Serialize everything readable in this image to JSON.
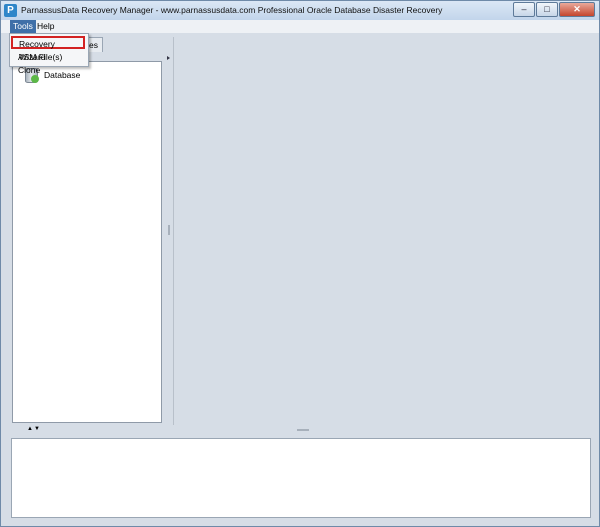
{
  "window": {
    "title": "ParnassusData Recovery Manager - www.parnassusdata.com  Professional Oracle Database Disaster Recovery",
    "app_icon_letter": "P",
    "controls": {
      "minimize": "–",
      "maximize": "□",
      "close": "✕"
    }
  },
  "menubar": {
    "tools": "Tools",
    "help": "Help"
  },
  "tools_menu": {
    "items": [
      "Recovery Wizard",
      "ASM File(s) Clone"
    ],
    "highlighted": "Recovery Wizard"
  },
  "left_panel": {
    "tab_visible_text": "es",
    "tree": {
      "items": [
        {
          "label": "Database",
          "icon": "database-add-icon"
        }
      ]
    }
  },
  "splitter": {
    "arrows": "▲▼"
  },
  "colors": {
    "menu_active": "#3f6fa8",
    "highlight_border": "#d32222",
    "panel_bg": "#d6dde6"
  }
}
